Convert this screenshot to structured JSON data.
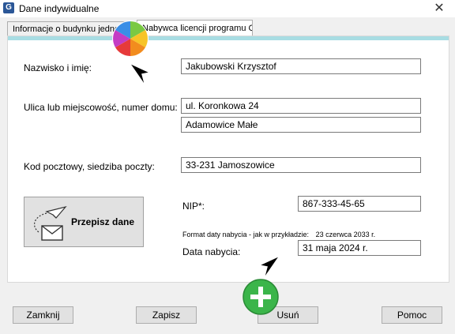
{
  "window": {
    "title": "Dane indywidualne",
    "app_icon": "G",
    "close_symbol": "✕"
  },
  "tabs": [
    {
      "label": "Informacje o budynku jednorodzinnym",
      "active": false
    },
    {
      "label": "Nabywca licencji programu Gito",
      "active": true
    }
  ],
  "form": {
    "name_label": "Nazwisko i imię:",
    "name_value": "Jakubowski Krzysztof",
    "street_label": "Ulica lub miejscowość, numer domu:",
    "street_value": "ul. Koronkowa 24",
    "town_value": "Adamowice Małe",
    "postal_label": "Kod pocztowy, siedziba poczty:",
    "postal_value": "33-231 Jamoszowice",
    "nip_label": "NIP*:",
    "nip_value": "867-333-45-65",
    "date_hint": "Format daty nabycia - jak w przykładzie:",
    "date_example": "23 czerwca 2033 r.",
    "date_label": "Data nabycia:",
    "date_value": "31 maja 2024 r."
  },
  "przepisz_button": {
    "label": "Przepisz dane",
    "icon": "paper-plane-envelope-icon"
  },
  "buttons": {
    "close": "Zamknij",
    "save": "Zapisz",
    "delete": "Usuń",
    "help": "Pomoc"
  },
  "colors": {
    "panel_accent": "#a8dde3",
    "plus_green": "#3bb54a"
  }
}
